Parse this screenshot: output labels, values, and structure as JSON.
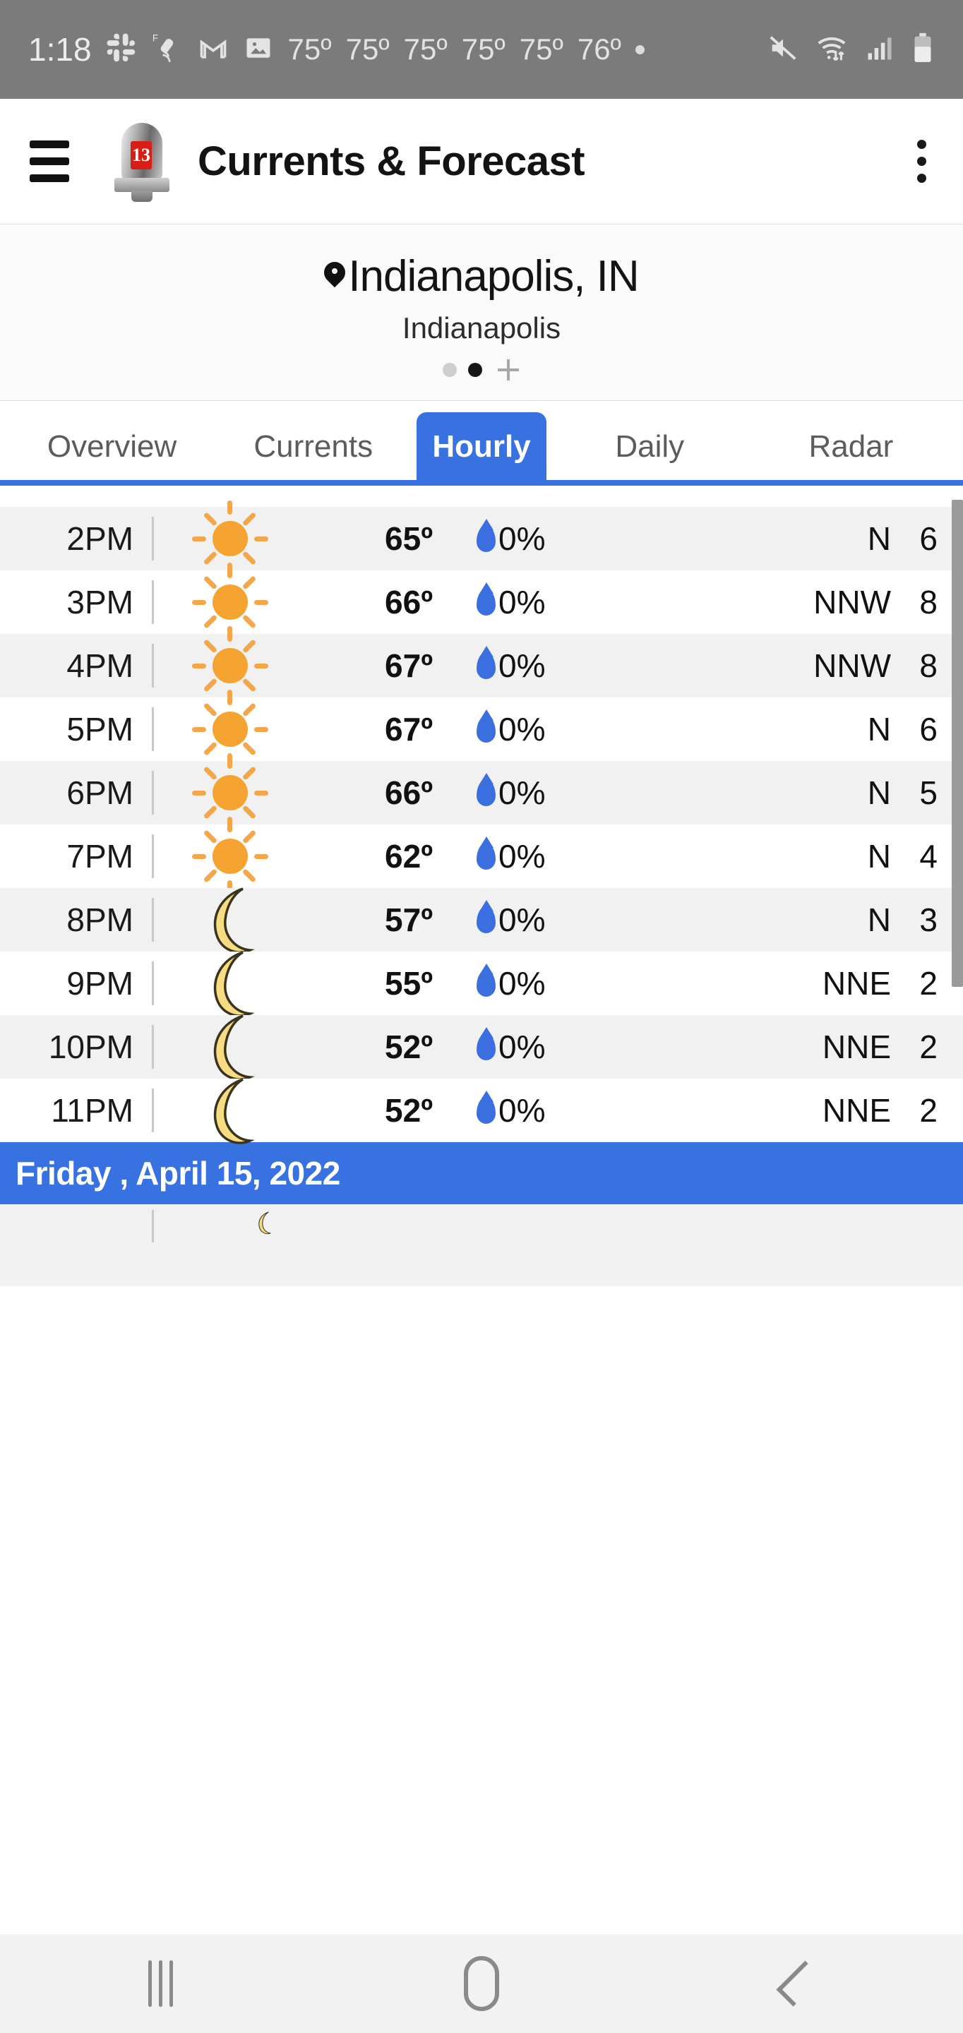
{
  "status_bar": {
    "time": "1:18",
    "icons_left": [
      "slack-icon",
      "satellite-signal-icon",
      "gmail-icon",
      "photo-icon"
    ],
    "temps": [
      "75º",
      "75º",
      "75º",
      "75º",
      "75º",
      "76º"
    ],
    "icons_right": [
      "mute-icon",
      "wifi-icon",
      "cellular-signal-icon",
      "battery-icon"
    ]
  },
  "app_bar": {
    "menu_icon": "hamburger-icon",
    "logo_label": "13",
    "title": "Currents & Forecast",
    "overflow_icon": "more-vertical-icon"
  },
  "location": {
    "pin_icon": "location-pin-icon",
    "title": "Indianapolis, IN",
    "subtitle": "Indianapolis",
    "page_dots": 2,
    "active_dot_index": 1,
    "add_label": "+"
  },
  "tabs": {
    "items": [
      {
        "label": "Overview",
        "active": false
      },
      {
        "label": "Currents",
        "active": false
      },
      {
        "label": "Hourly",
        "active": true
      },
      {
        "label": "Daily",
        "active": false
      },
      {
        "label": "Radar",
        "active": false
      }
    ]
  },
  "hourly": {
    "rows": [
      {
        "time": "2PM",
        "icon": "sun",
        "temp": "65º",
        "pop": "0%",
        "wind_dir": "N",
        "wind_spd": "6"
      },
      {
        "time": "3PM",
        "icon": "sun",
        "temp": "66º",
        "pop": "0%",
        "wind_dir": "NNW",
        "wind_spd": "8"
      },
      {
        "time": "4PM",
        "icon": "sun",
        "temp": "67º",
        "pop": "0%",
        "wind_dir": "NNW",
        "wind_spd": "8"
      },
      {
        "time": "5PM",
        "icon": "sun",
        "temp": "67º",
        "pop": "0%",
        "wind_dir": "N",
        "wind_spd": "6"
      },
      {
        "time": "6PM",
        "icon": "sun",
        "temp": "66º",
        "pop": "0%",
        "wind_dir": "N",
        "wind_spd": "5"
      },
      {
        "time": "7PM",
        "icon": "sun",
        "temp": "62º",
        "pop": "0%",
        "wind_dir": "N",
        "wind_spd": "4"
      },
      {
        "time": "8PM",
        "icon": "moon",
        "temp": "57º",
        "pop": "0%",
        "wind_dir": "N",
        "wind_spd": "3"
      },
      {
        "time": "9PM",
        "icon": "moon",
        "temp": "55º",
        "pop": "0%",
        "wind_dir": "NNE",
        "wind_spd": "2"
      },
      {
        "time": "10PM",
        "icon": "moon",
        "temp": "52º",
        "pop": "0%",
        "wind_dir": "NNE",
        "wind_spd": "2"
      },
      {
        "time": "11PM",
        "icon": "moon",
        "temp": "52º",
        "pop": "0%",
        "wind_dir": "NNE",
        "wind_spd": "2"
      }
    ],
    "date_banner": "Friday , April 15, 2022"
  },
  "nav_bar": {
    "recents_label": "recents-icon",
    "home_label": "home-icon",
    "back_label": "back-icon"
  },
  "colors": {
    "accent_blue": "#3871e0",
    "sun_orange": "#F5A431",
    "moon_yellow": "#F7DC82",
    "drop_blue": "#3b6fe0",
    "status_gray": "#7b7b7b",
    "row_alt": "#f1f1f1"
  }
}
